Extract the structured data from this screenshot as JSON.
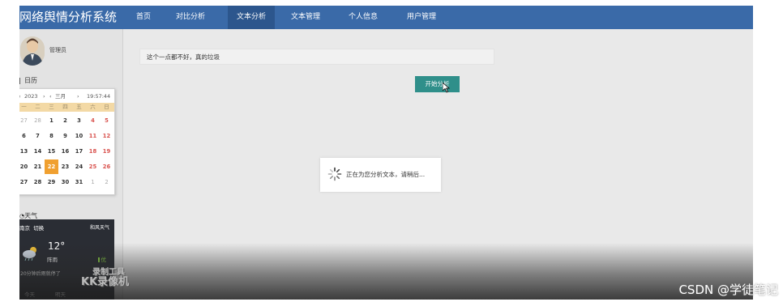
{
  "app": {
    "title": "网络舆情分析系统",
    "nav": [
      {
        "label": "首页"
      },
      {
        "label": "对比分析"
      },
      {
        "label": "文本分析"
      },
      {
        "label": "文本管理"
      },
      {
        "label": "个人信息"
      },
      {
        "label": "用户管理"
      }
    ]
  },
  "sidebar": {
    "user_label": "管理员",
    "calendar_title": "日历",
    "calendar": {
      "year": "2023",
      "month": "三月",
      "time": "19:57:44",
      "weekdays": [
        "一",
        "二",
        "三",
        "四",
        "五",
        "六",
        "日"
      ],
      "rows": [
        [
          "27",
          "28",
          "1",
          "2",
          "3",
          "4",
          "5"
        ],
        [
          "6",
          "7",
          "8",
          "9",
          "10",
          "11",
          "12"
        ],
        [
          "13",
          "14",
          "15",
          "16",
          "17",
          "18",
          "19"
        ],
        [
          "20",
          "21",
          "22",
          "23",
          "24",
          "25",
          "26"
        ],
        [
          "27",
          "28",
          "29",
          "30",
          "31",
          "1",
          "2"
        ]
      ],
      "today": "22"
    },
    "weather_title": "天气",
    "weather": {
      "city": "南京",
      "district": "切换",
      "wind": "和风天气",
      "temp": "12°",
      "condition": "阵雨",
      "aqi": "优",
      "note": "20分钟后雨就停了",
      "tabs": [
        "今天",
        "明天"
      ]
    }
  },
  "main": {
    "input_value": "这个一点都不好，真的垃圾",
    "start_button": "开始分析",
    "loading_text": "正在为您分析文本，请稍后..."
  },
  "watermarks": {
    "recorder_line1": "录制工具",
    "recorder_line2": "KK录像机",
    "csdn": "CSDN @学徒笔记"
  },
  "colors": {
    "topbar": "#3a6aa8",
    "nav_active": "#2c568d",
    "button": "#2f8f8a",
    "calendar_today": "#f0a030",
    "weekend": "#d9534f"
  }
}
